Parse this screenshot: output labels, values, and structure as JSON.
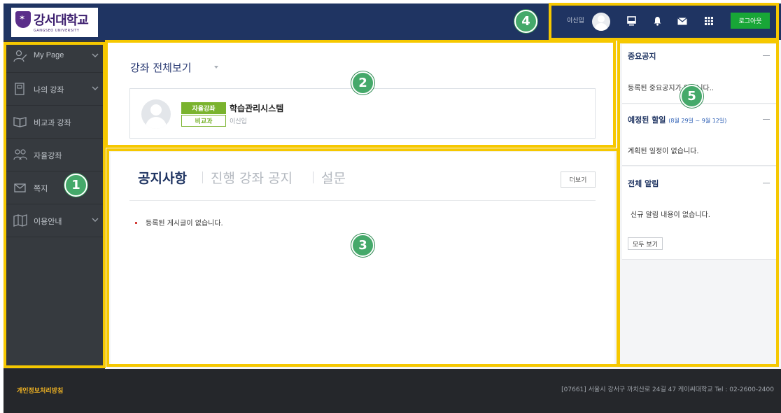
{
  "header": {
    "logo": {
      "name": "강서대학교",
      "sub": "GANGSEO UNIVERSITY"
    },
    "user_name": "이신입",
    "logout_label": "로그아웃",
    "icons": [
      "avatar-icon",
      "monitor-icon",
      "bell-icon",
      "mail-icon",
      "grid-icon"
    ]
  },
  "sidebar": {
    "items": [
      {
        "label": "My Page",
        "icon": "user-icon",
        "has_submenu": true
      },
      {
        "label": "나의 강좌",
        "icon": "book-icon",
        "has_submenu": true
      },
      {
        "label": "비교과 강좌",
        "icon": "open-book-icon",
        "has_submenu": false
      },
      {
        "label": "자율강좌",
        "icon": "group-icon",
        "has_submenu": false
      },
      {
        "label": "쪽지",
        "icon": "envelope-icon",
        "has_submenu": false
      },
      {
        "label": "이용안내",
        "icon": "map-icon",
        "has_submenu": true
      }
    ]
  },
  "course_panel": {
    "title": "강좌 전체보기",
    "course": {
      "badge_type": "자율강좌",
      "badge_category": "비교과",
      "name": "학습관리시스템",
      "professor": "이신입"
    }
  },
  "notices": {
    "tabs": [
      "공지사항",
      "진행 강좌 공지",
      "설문"
    ],
    "active_tab": "공지사항",
    "more_label": "더보기",
    "empty_message": "등록된 게시글이 없습니다."
  },
  "right_panel": {
    "important": {
      "title": "중요공지",
      "message": "등록된 중요공지가 없습니다.."
    },
    "schedule": {
      "title": "예정된 할일",
      "range": "(8월 29일 ~ 9월 12일)",
      "message": "계획된 일정이 없습니다."
    },
    "alerts": {
      "title": "전체 알림",
      "message": "신규 알림 내용이 없습니다.",
      "button": "모두 보기"
    }
  },
  "footer": {
    "privacy_link": "개인정보처리방침",
    "address": "[07661] 서울시 강서구 까치산로 24길 47 케이씨대학교  Tel : 02-2600-2400"
  },
  "markers": [
    "1",
    "2",
    "3",
    "4",
    "5"
  ],
  "colors": {
    "header_bg": "#1f3462",
    "sidebar_bg": "#363a3f",
    "accent_green": "#18a637",
    "badge_green": "#7ab32e",
    "highlight_frame": "#f6c800",
    "marker_green": "#45a96a",
    "footer_link": "#f0b323"
  }
}
